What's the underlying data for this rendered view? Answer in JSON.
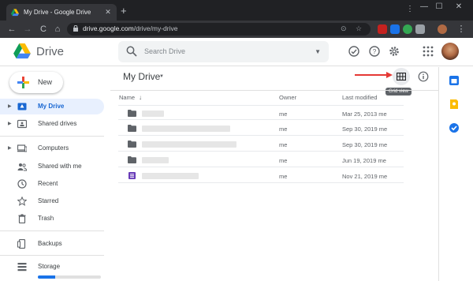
{
  "browser": {
    "tab_title": "My Drive - Google Drive",
    "tab_close": "✕",
    "new_tab": "+",
    "url_host": "drive.google.com",
    "url_path": "/drive/my-drive",
    "window": {
      "menu": "⋮",
      "minimize": "—",
      "maximize": "☐",
      "close": "✕"
    },
    "nav": {
      "back": "←",
      "forward": "→",
      "reload": "C",
      "home": "⌂"
    },
    "omni_icons": {
      "cast": "⊙",
      "bookmark": "☆"
    }
  },
  "drive": {
    "brand": "Drive",
    "search_placeholder": "Search Drive",
    "search_dropdown": "▼",
    "new_button": "New",
    "sidebar": {
      "items": [
        {
          "label": "My Drive",
          "icon": "my-drive-icon",
          "active": true,
          "expandable": true
        },
        {
          "label": "Shared drives",
          "icon": "shared-drives-icon",
          "active": false,
          "expandable": true
        },
        {
          "label": "Computers",
          "icon": "computers-icon",
          "active": false,
          "expandable": true
        },
        {
          "label": "Shared with me",
          "icon": "people-icon",
          "active": false,
          "expandable": false
        },
        {
          "label": "Recent",
          "icon": "clock-icon",
          "active": false,
          "expandable": false
        },
        {
          "label": "Starred",
          "icon": "star-icon",
          "active": false,
          "expandable": false
        },
        {
          "label": "Trash",
          "icon": "trash-icon",
          "active": false,
          "expandable": false
        },
        {
          "label": "Backups",
          "icon": "backups-icon",
          "active": false,
          "expandable": false
        },
        {
          "label": "Storage",
          "icon": "storage-icon",
          "active": false,
          "expandable": false
        }
      ],
      "storage_used_fraction": 0.28
    },
    "main": {
      "breadcrumb": "My Drive",
      "breadcrumb_dropdown": "▼",
      "view_tooltip": "Grid view",
      "sort_arrow": "↓",
      "columns": {
        "name": "Name",
        "owner": "Owner",
        "last_modified": "Last modified"
      },
      "rows": [
        {
          "type": "folder",
          "owner": "me",
          "modified": "Mar 25, 2013 me"
        },
        {
          "type": "folder",
          "owner": "me",
          "modified": "Sep 30, 2019 me"
        },
        {
          "type": "folder",
          "owner": "me",
          "modified": "Sep 30, 2019 me"
        },
        {
          "type": "folder",
          "owner": "me",
          "modified": "Jun 19, 2019 me"
        },
        {
          "type": "form",
          "owner": "me",
          "modified": "Nov 21, 2019 me"
        }
      ]
    },
    "colors": {
      "accent": "#1a73e8",
      "active_bg": "#e8f0fe",
      "annotation_arrow": "#e53935",
      "calendar": "#1a73e8",
      "keep": "#fbbc04",
      "tasks": "#1a73e8"
    }
  }
}
